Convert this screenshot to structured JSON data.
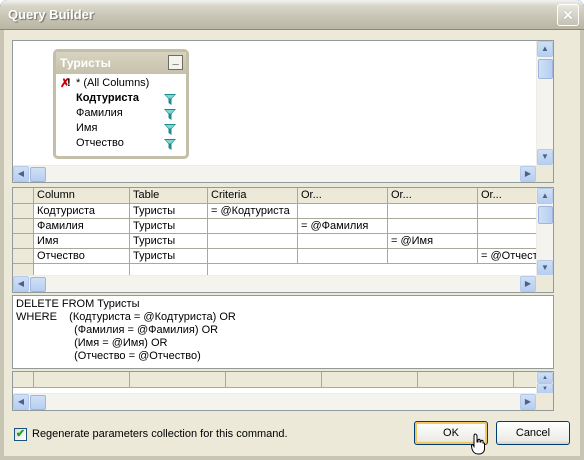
{
  "window": {
    "title": "Query Builder",
    "close_label": "✕"
  },
  "diagram": {
    "table": {
      "name": "Туристы",
      "minimize_label": "_",
      "all_columns": "* (All Columns)",
      "columns": [
        "Кодтуриста",
        "Фамилия",
        "Имя",
        "Отчество"
      ]
    }
  },
  "grid": {
    "headers": [
      "Column",
      "Table",
      "Criteria",
      "Or...",
      "Or...",
      "Or..."
    ],
    "rows": [
      [
        "Кодтуриста",
        "Туристы",
        "= @Кодтуриста",
        "",
        "",
        ""
      ],
      [
        "Фамилия",
        "Туристы",
        "",
        "= @Фамилия",
        "",
        ""
      ],
      [
        "Имя",
        "Туристы",
        "",
        "",
        "= @Имя",
        ""
      ],
      [
        "Отчество",
        "Туристы",
        "",
        "",
        "",
        "= @Отчество"
      ]
    ]
  },
  "sql": {
    "text": "DELETE FROM Туристы\nWHERE    (Кодтуриста = @Кодтуриста) OR\n                   (Фамилия = @Фамилия) OR\n                   (Имя = @Имя) OR\n                   (Отчество = @Отчество)"
  },
  "footer": {
    "regenerate_label": "Regenerate parameters collection for this command.",
    "regenerate_checked": true,
    "ok_label": "OK",
    "cancel_label": "Cancel"
  },
  "colors": {
    "titlebar_text": "#ffffff",
    "dialog_bg": "#ece9d8",
    "criteria_funnel": "#1d8a8c"
  }
}
